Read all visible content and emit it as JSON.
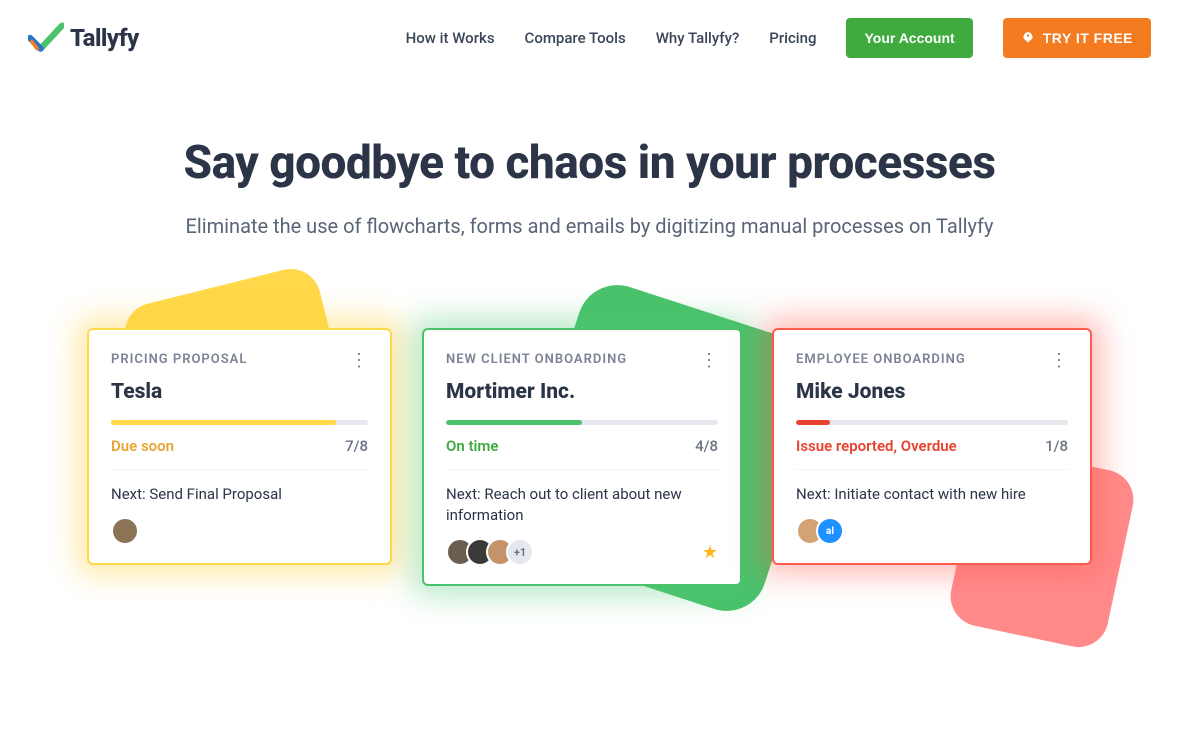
{
  "header": {
    "logo_text": "Tallyfy",
    "nav": {
      "how": "How it Works",
      "compare": "Compare Tools",
      "why": "Why Tallyfy?",
      "pricing": "Pricing"
    },
    "account_btn": "Your Account",
    "trial_btn": "TRY IT FREE"
  },
  "hero": {
    "title": "Say goodbye to chaos in your processes",
    "subtitle": "Eliminate the use of flowcharts, forms and emails by digitizing manual processes on Tallyfy"
  },
  "cards": {
    "card1": {
      "category": "PRICING PROPOSAL",
      "title": "Tesla",
      "status": "Due soon",
      "progress": "7/8",
      "next": "Next: Send Final Proposal",
      "progress_pct": "87.5%",
      "color": "#ffd94a"
    },
    "card2": {
      "category": "NEW CLIENT ONBOARDING",
      "title": "Mortimer Inc.",
      "status": "On time",
      "progress": "4/8",
      "next": "Next: Reach out to client about new information",
      "more": "+1",
      "progress_pct": "50%",
      "color": "#4ac26b"
    },
    "card3": {
      "category": "EMPLOYEE ONBOARDING",
      "title": "Mike Jones",
      "status": "Issue reported, Overdue",
      "progress": "1/8",
      "next": "Next: Initiate contact with new hire",
      "avatar_label": "al",
      "progress_pct": "12.5%",
      "color": "#e8412e"
    }
  }
}
